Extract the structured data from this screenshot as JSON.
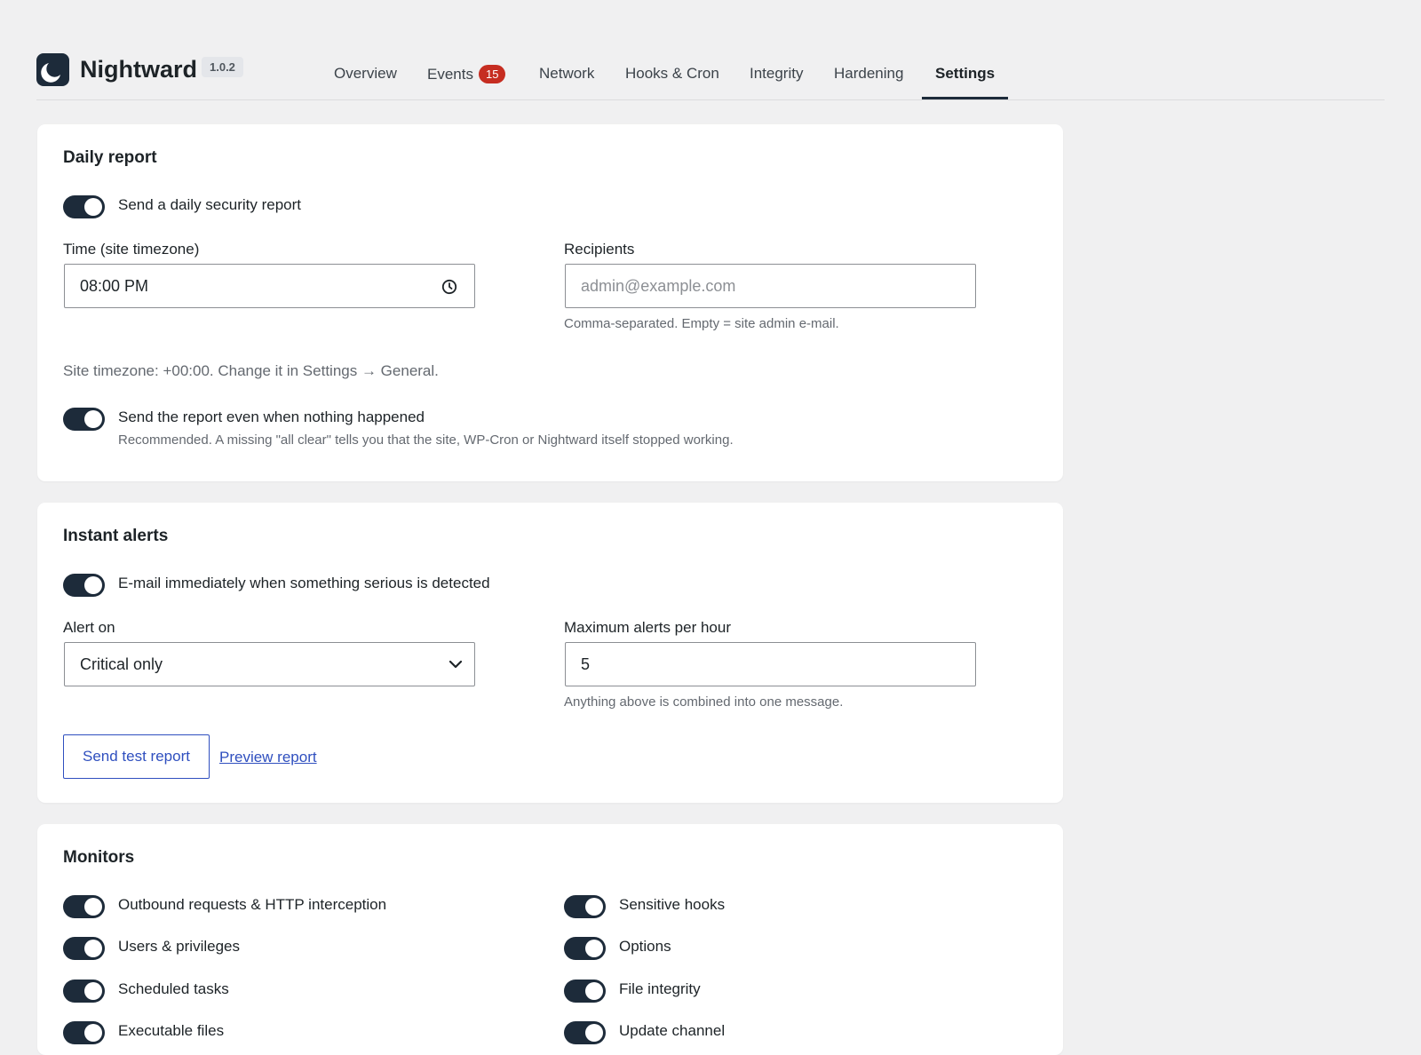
{
  "header": {
    "brand": "Nightward",
    "version": "1.0.2",
    "tabs": [
      {
        "label": "Overview"
      },
      {
        "label": "Events",
        "badge": "15"
      },
      {
        "label": "Network"
      },
      {
        "label": "Hooks & Cron"
      },
      {
        "label": "Integrity"
      },
      {
        "label": "Hardening"
      },
      {
        "label": "Settings",
        "active": true
      }
    ]
  },
  "daily_report": {
    "title": "Daily report",
    "toggle_send_label": "Send a daily security report",
    "toggle_send_on": true,
    "time_label": "Time (site timezone)",
    "time_value": "08:00 PM",
    "recipients_label": "Recipients",
    "recipients_placeholder": "admin@example.com",
    "recipients_value": "",
    "recipients_help": "Comma-separated. Empty = site admin e-mail.",
    "timezone_note": "Site timezone: +00:00. Change it in Settings → General.",
    "toggle_empty_label": "Send the report even when nothing happened",
    "toggle_empty_on": true,
    "toggle_empty_help": "Recommended. A missing \"all clear\" tells you that the site, WP-Cron or Nightward itself stopped working."
  },
  "instant_alerts": {
    "title": "Instant alerts",
    "toggle_label": "E-mail immediately when something serious is detected",
    "toggle_on": true,
    "alert_on_label": "Alert on",
    "alert_on_value": "Critical only",
    "max_label": "Maximum alerts per hour",
    "max_value": "5",
    "max_help": "Anything above is combined into one message.",
    "send_test_label": "Send test report",
    "preview_label": "Preview report"
  },
  "monitors": {
    "title": "Monitors",
    "left": [
      {
        "label": "Outbound requests & HTTP interception",
        "on": true
      },
      {
        "label": "Users & privileges",
        "on": true
      },
      {
        "label": "Scheduled tasks",
        "on": true
      },
      {
        "label": "Executable files",
        "on": true
      }
    ],
    "right": [
      {
        "label": "Sensitive hooks",
        "on": true
      },
      {
        "label": "Options",
        "on": true
      },
      {
        "label": "File integrity",
        "on": true
      },
      {
        "label": "Update channel",
        "on": true
      }
    ]
  },
  "colors": {
    "accent": "#1d2b3a",
    "link": "#2f4fbf",
    "badge": "#c62d21",
    "background": "#f0f0f1"
  }
}
